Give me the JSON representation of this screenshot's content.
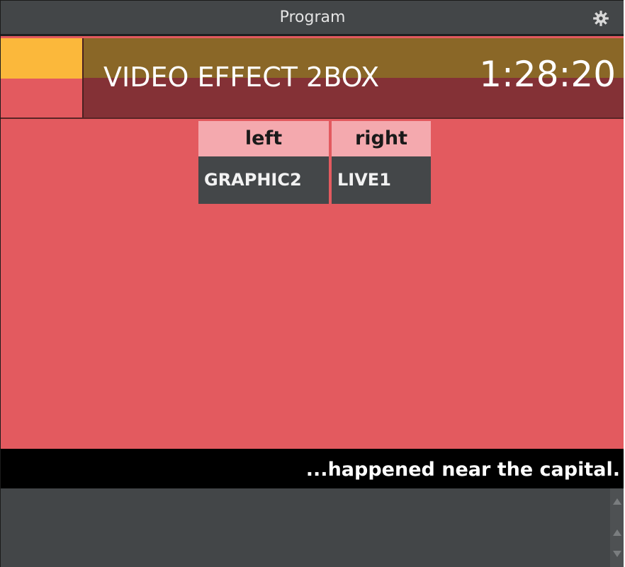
{
  "window": {
    "title": "Program",
    "settings_icon": "gear-icon"
  },
  "header": {
    "effect_name": "VIDEO EFFECT 2BOX",
    "timecode": "1:28:20",
    "colors": {
      "status_top": "#fbb83b",
      "status_bottom": "#e35a5f",
      "band_top": "#8a6727",
      "band_bottom": "#843136"
    }
  },
  "sources": {
    "columns": [
      {
        "header": "left",
        "value": "GRAPHIC2"
      },
      {
        "header": "right",
        "value": "LIVE1"
      }
    ]
  },
  "caption": {
    "text": "...happened near the capital."
  },
  "notes": {
    "text": ""
  },
  "colors": {
    "panel_background": "#e35a5f",
    "caption_background": "#000000",
    "notes_background": "#434648"
  }
}
